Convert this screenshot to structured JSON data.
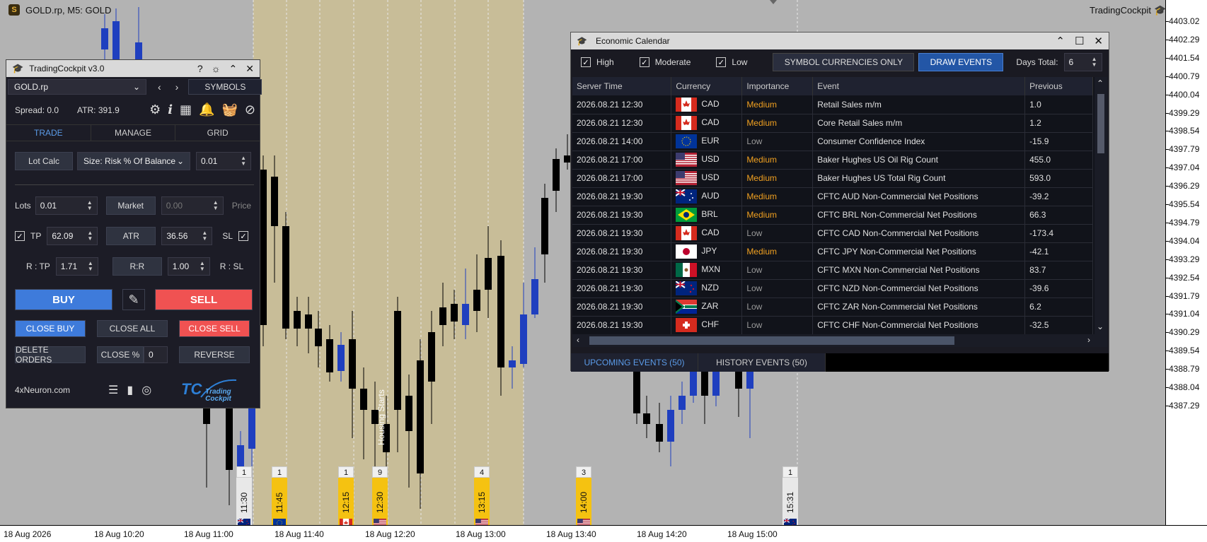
{
  "chart": {
    "title": "GOLD.rp, M5:  GOLD",
    "brand": "TradingCockpit",
    "annotation": "Housing Starts",
    "price_labels": [
      "4403.02",
      "4402.29",
      "4401.54",
      "4400.79",
      "4400.04",
      "4399.29",
      "4398.54",
      "4397.79",
      "4397.04",
      "4396.29",
      "4395.54",
      "4394.79",
      "4394.04",
      "4393.29",
      "4392.54",
      "4391.79",
      "4391.04",
      "4390.29",
      "4389.54",
      "4388.79",
      "4388.04",
      "4387.29"
    ],
    "time_labels": [
      "18 Aug 2026",
      "18 Aug 10:20",
      "18 Aug 11:00",
      "18 Aug 11:40",
      "18 Aug 12:20",
      "18 Aug 13:00",
      "18 Aug 13:40",
      "18 Aug 14:20",
      "18 Aug 15:00"
    ],
    "event_markers": [
      {
        "count": "1",
        "time": "11:30",
        "color": "#e8e8e8",
        "flag": "nz"
      },
      {
        "count": "1",
        "time": "11:45",
        "color": "#f5c211",
        "flag": "eu"
      },
      {
        "count": "1",
        "time": "12:15",
        "color": "#f5c211",
        "flag": "ca"
      },
      {
        "count": "9",
        "time": "12:30",
        "color": "#f5c211",
        "flag": "us"
      },
      {
        "count": "4",
        "time": "13:15",
        "color": "#f5c211",
        "flag": "us"
      },
      {
        "count": "3",
        "time": "14:00",
        "color": "#f5c211",
        "flag": "us"
      },
      {
        "count": "1",
        "time": "15:31",
        "color": "#e8e8e8",
        "flag": "nz"
      }
    ],
    "colors": {
      "bull": "#1f3fbf",
      "bear": "#000000",
      "session": "#c8bd98",
      "background": "#b3b3b3"
    }
  },
  "tc": {
    "title": "TradingCockpit v3.0",
    "symbol": "GOLD.rp",
    "symbols_btn": "SYMBOLS",
    "spread": "Spread: 0.0",
    "atr": "ATR: 391.9",
    "tabs": [
      "TRADE",
      "MANAGE",
      "GRID"
    ],
    "lot_calc": "Lot Calc",
    "size_mode": "Size: Risk % Of Balance",
    "risk_value": "0.01",
    "lots_label": "Lots",
    "lots_value": "0.01",
    "market_btn": "Market",
    "price_value": "0.00",
    "price_label": "Price",
    "tp_label": "TP",
    "tp_value": "62.09",
    "atr_btn": "ATR",
    "atr_value": "36.56",
    "sl_label": "SL",
    "rtp_label": "R : TP",
    "rtp_value": "1.71",
    "rr_btn": "R:R",
    "rsl_value": "1.00",
    "rsl_label": "R : SL",
    "buy": "BUY",
    "sell": "SELL",
    "close_buy": "CLOSE BUY",
    "close_all": "CLOSE ALL",
    "close_sell": "CLOSE SELL",
    "delete_orders": "DELETE ORDERS",
    "close_pct": "CLOSE %",
    "close_pct_value": "0",
    "reverse": "REVERSE",
    "footer_link": "4xNeuron.com",
    "logo_text": "Trading Cockpit"
  },
  "ec": {
    "title": "Economic Calendar",
    "filters": [
      "High",
      "Moderate",
      "Low"
    ],
    "symbol_only_btn": "SYMBOL CURRENCIES ONLY",
    "draw_events_btn": "DRAW EVENTS",
    "days_total_label": "Days Total:",
    "days_total_value": "6",
    "columns": [
      "Server Time",
      "Currency",
      "Importance",
      "Event",
      "Previous"
    ],
    "rows": [
      {
        "time": "2026.08.21 12:30",
        "flag": "ca",
        "currency": "CAD",
        "importance": "Medium",
        "event": "Retail Sales m/m",
        "previous": "1.0"
      },
      {
        "time": "2026.08.21 12:30",
        "flag": "ca",
        "currency": "CAD",
        "importance": "Medium",
        "event": "Core Retail Sales m/m",
        "previous": "1.2"
      },
      {
        "time": "2026.08.21 14:00",
        "flag": "eu",
        "currency": "EUR",
        "importance": "Low",
        "event": "Consumer Confidence Index",
        "previous": "-15.9"
      },
      {
        "time": "2026.08.21 17:00",
        "flag": "us",
        "currency": "USD",
        "importance": "Medium",
        "event": "Baker Hughes US Oil Rig Count",
        "previous": "455.0"
      },
      {
        "time": "2026.08.21 17:00",
        "flag": "us",
        "currency": "USD",
        "importance": "Medium",
        "event": "Baker Hughes US Total Rig Count",
        "previous": "593.0"
      },
      {
        "time": "2026.08.21 19:30",
        "flag": "au",
        "currency": "AUD",
        "importance": "Medium",
        "event": "CFTC AUD Non-Commercial Net Positions",
        "previous": "-39.2"
      },
      {
        "time": "2026.08.21 19:30",
        "flag": "br",
        "currency": "BRL",
        "importance": "Medium",
        "event": "CFTC BRL Non-Commercial Net Positions",
        "previous": "66.3"
      },
      {
        "time": "2026.08.21 19:30",
        "flag": "ca",
        "currency": "CAD",
        "importance": "Low",
        "event": "CFTC CAD Non-Commercial Net Positions",
        "previous": "-173.4"
      },
      {
        "time": "2026.08.21 19:30",
        "flag": "jp",
        "currency": "JPY",
        "importance": "Medium",
        "event": "CFTC JPY Non-Commercial Net Positions",
        "previous": "-42.1"
      },
      {
        "time": "2026.08.21 19:30",
        "flag": "mx",
        "currency": "MXN",
        "importance": "Low",
        "event": "CFTC MXN Non-Commercial Net Positions",
        "previous": "83.7"
      },
      {
        "time": "2026.08.21 19:30",
        "flag": "nz",
        "currency": "NZD",
        "importance": "Low",
        "event": "CFTC NZD Non-Commercial Net Positions",
        "previous": "-39.6"
      },
      {
        "time": "2026.08.21 19:30",
        "flag": "za",
        "currency": "ZAR",
        "importance": "Low",
        "event": "CFTC ZAR Non-Commercial Net Positions",
        "previous": "6.2"
      },
      {
        "time": "2026.08.21 19:30",
        "flag": "ch",
        "currency": "CHF",
        "importance": "Low",
        "event": "CFTC CHF Non-Commercial Net Positions",
        "previous": "-32.5"
      }
    ],
    "bottom_tabs": [
      "UPCOMING EVENTS (50)",
      "HISTORY EVENTS (50)"
    ]
  }
}
